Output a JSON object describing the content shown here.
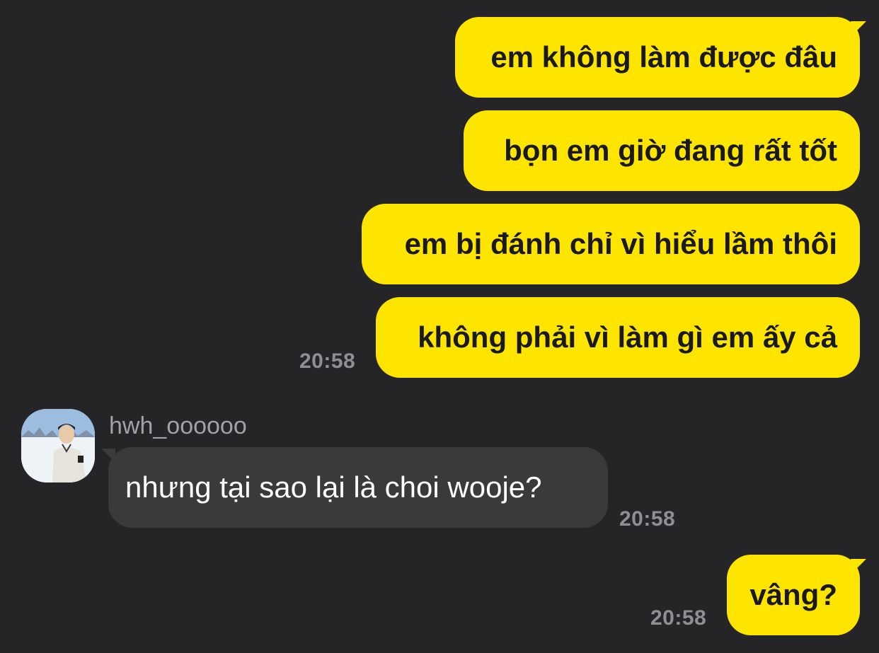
{
  "messages": [
    {
      "text": "em không làm được đâu"
    },
    {
      "text": "bọn em giờ đang rất tốt"
    },
    {
      "text": "em bị đánh chỉ vì hiểu lầm thôi"
    },
    {
      "text": "không phải vì làm gì em ấy cả",
      "time": "20:58"
    },
    {
      "sender": "hwh_oooooo",
      "text": "nhưng tại sao lại là choi wooje?",
      "time": "20:58"
    },
    {
      "text": "vâng?",
      "time": "20:58"
    }
  ],
  "colors": {
    "background": "#252527",
    "outgoing_bubble": "#fee500",
    "incoming_bubble": "#3a3a3c",
    "timestamp": "#8e8e93"
  }
}
